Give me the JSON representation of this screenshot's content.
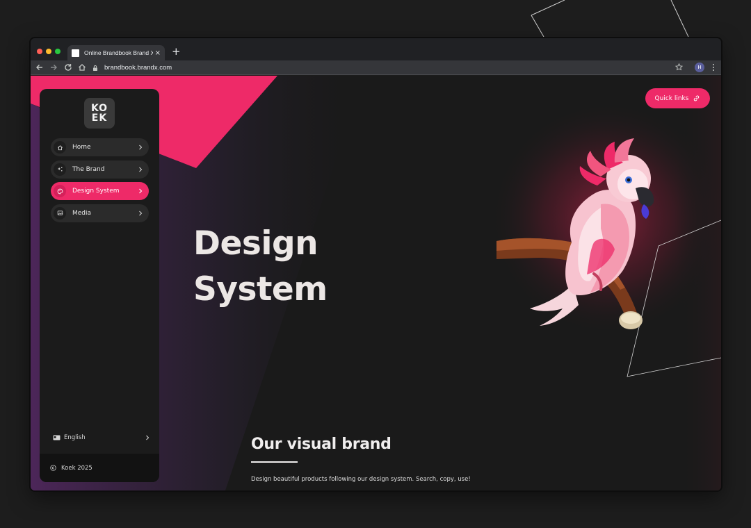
{
  "browser": {
    "tab_title": "Online Brandbook Brand X",
    "close_label": "×",
    "new_tab_label": "+",
    "url": "brandbook.brandx.com",
    "profile_initial": "H"
  },
  "logo": {
    "line1": "KO",
    "line2": "EK"
  },
  "nav": {
    "items": [
      {
        "label": "Home",
        "icon": "home-icon",
        "active": false
      },
      {
        "label": "The Brand",
        "icon": "sparkle-icon",
        "active": false
      },
      {
        "label": "Design System",
        "icon": "palette-icon",
        "active": true
      },
      {
        "label": "Media",
        "icon": "image-icon",
        "active": false
      }
    ]
  },
  "language": {
    "label": "English"
  },
  "footer": {
    "text": "Koek 2025"
  },
  "quick_links": {
    "label": "Quick links"
  },
  "hero": {
    "line1": "Design",
    "line2": "System"
  },
  "section": {
    "title": "Our visual brand",
    "subtitle": "Design beautiful products following our design system. Search, copy, use!"
  },
  "colors": {
    "accent": "#ee2a68",
    "background": "#1a1a1a",
    "sidebar": "#1b1b1b",
    "nav_item": "#2b2b2b"
  }
}
